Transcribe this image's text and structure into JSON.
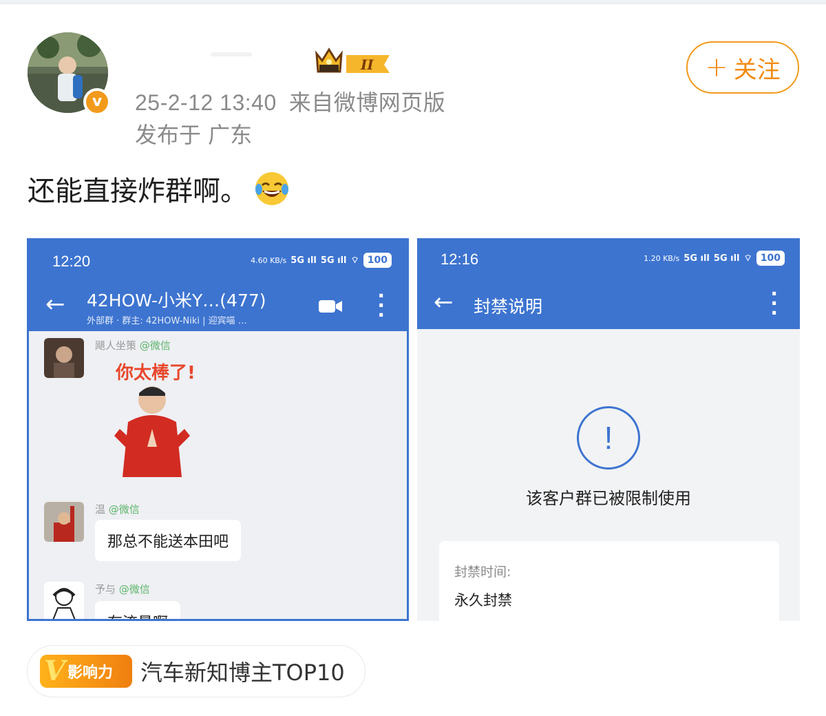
{
  "post": {
    "time": "25-2-12 13:40",
    "source": "来自微博网页版",
    "location": "发布于 广东",
    "follow_label": "关注",
    "text": "还能直接炸群啊。",
    "emoji": "laughing-tears-emoji"
  },
  "image_left": {
    "status_time": "12:20",
    "net_speed": "4.60 KB/s",
    "battery": "100",
    "title": "42HOW-小米Y…(477)",
    "subtitle": "外部群 · 群主: 42HOW-Niki | 迎宾喵 …",
    "messages": [
      {
        "name": "飓人坐策",
        "tag": "@微信",
        "sticker_text": "你太棒了!"
      },
      {
        "name": "温",
        "tag": "@微信",
        "text": "那总不能送本田吧"
      },
      {
        "name": "予与",
        "tag": "@微信",
        "text": "有流量啊"
      }
    ]
  },
  "image_right": {
    "status_time": "12:16",
    "net_speed": "1.20 KB/s",
    "battery": "100",
    "title": "封禁说明",
    "warning_symbol": "!",
    "message": "该客户群已被限制使用",
    "ban_label": "封禁时间:",
    "ban_value": "永久封禁"
  },
  "influence": {
    "badge": "影响力",
    "text": "汽车新知博主TOP10"
  },
  "colors": {
    "accent_orange": "#f28b12",
    "app_blue": "#3d74d0"
  }
}
